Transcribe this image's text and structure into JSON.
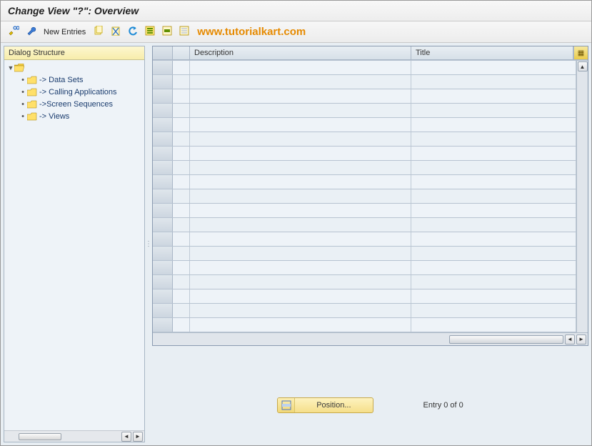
{
  "title": "Change View \"?\": Overview",
  "watermark": "www.tutorialkart.com",
  "toolbar": {
    "new_entries_label": "New Entries"
  },
  "tree": {
    "header": "Dialog Structure",
    "root_expanded": true,
    "children": [
      {
        "label": "-> Data Sets"
      },
      {
        "label": "-> Calling Applications"
      },
      {
        "label": "->Screen Sequences"
      },
      {
        "label": "-> Views"
      }
    ]
  },
  "grid": {
    "columns": {
      "description": "Description",
      "title": "Title"
    },
    "rows": [],
    "empty_row_count": 20
  },
  "footer": {
    "position_label": "Position...",
    "entry_text": "Entry 0 of 0"
  }
}
